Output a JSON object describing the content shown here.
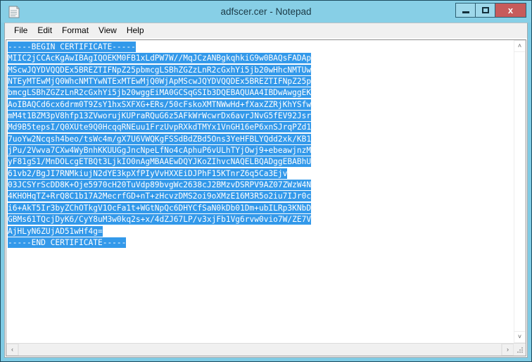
{
  "window": {
    "title": "adfscer.cer - Notepad",
    "icon": "notepad-document-icon",
    "accent_frame_color": "#7fcbe4",
    "titlebar_color": "#87cfe6",
    "close_button_color": "#c75b5b"
  },
  "caption_buttons": {
    "minimize_label": "",
    "maximize_label": "",
    "close_label": "x"
  },
  "menu": {
    "items": [
      {
        "label": "File"
      },
      {
        "label": "Edit"
      },
      {
        "label": "Format"
      },
      {
        "label": "View"
      },
      {
        "label": "Help"
      }
    ]
  },
  "editor": {
    "selection_color": "#3399ea",
    "selection_text_color": "#ffffff",
    "lines": [
      "-----BEGIN CERTIFICATE-----",
      "MIIC2jCCAcKgAwIBAgIQOEKM0FB1xLdPW7W//MqJCzANBgkqhkiG9w0BAQsFADAp",
      "MScwJQYDVQQDEx5BREZTIFNpZ25pbmcgLSBhZGZzLnR2cGxhYi5jb20wHhcNMTUw",
      "NTEyMTEwMjQ0WhcNMTYwNTExMTEwMjQ0WjApMScwJQYDVQQDEx5BREZTIFNpZ25p",
      "bmcgLSBhZGZzLnR2cGxhYi5jb20wggEiMA0GCSqGSIb3DQEBAQUAA4IBDwAwggEK",
      "AoIBAQCd6cx6drm0T9ZsY1hxSXFXG+ERs/50cFskoXMTNWwHd+fXaxZZRjKhYSfw",
      "mM4t1BZM3pV8hfp13ZVworujKUPraRQuG6z5AFkWrWcwrDx6avrJNvG5fEV92Jsr",
      "Md9B5tepsI/Q0XUte9Q0HcqqRNEuu1FrzUvpRXkdTMYx1VnGH16eP6xnSJrqPZd1",
      "7uoYw2Ncqsh4beo/tsWc4m/gX7U6VWQKgFSSdBdZBd5Ons3YeHFBLYQdd2xk/KB1",
      "jPu/2Vwva7CXw4WyBnhKKUUGgJncNpeLfNo4cAphuP6vULhTYjOwj9+ebeawjnzM",
      "yF81gS1/MnDOLcgETBQt3LjkIO0nAgMBAAEwDQYJKoZIhvcNAQELBQADggEBABhU",
      "61vb2/BgJI7RNMkiujN2dYE3kpXfPIyVvHXXEiDJPhF15KTnrZ6q5Ca3Ejv",
      "03JCSYrScDD8K+Oje5970cH20TuVdp89bvgWc2638cJ2BMzvDSRPV9AZ07ZWzW4N",
      "4KHOHqTZ+RrQ8C1b17A2MecrfGD+nT+zHcvzDMS2oi9oXMzE16M3R5o2iu7IJr0c",
      "i6+AkT5Ir3byZChOTkgV1OcFa1t+WGtNpQc6DHYCfSaN0kDb01Dm+ubILRp3KNbD",
      "GBMs61TQcjDyK6/CyY8uM3w0kq2s+x/4dZJ67LP/v3xjFb1Vg6rvw0vio7W/ZE7V",
      "AjHLyN6ZUjAD51wHf4g=",
      "-----END CERTIFICATE-----"
    ]
  },
  "scrollbars": {
    "vertical": {
      "up_arrow": "˄",
      "down_arrow": "˅"
    },
    "horizontal": {
      "left_arrow": "‹",
      "right_arrow": "›"
    }
  }
}
